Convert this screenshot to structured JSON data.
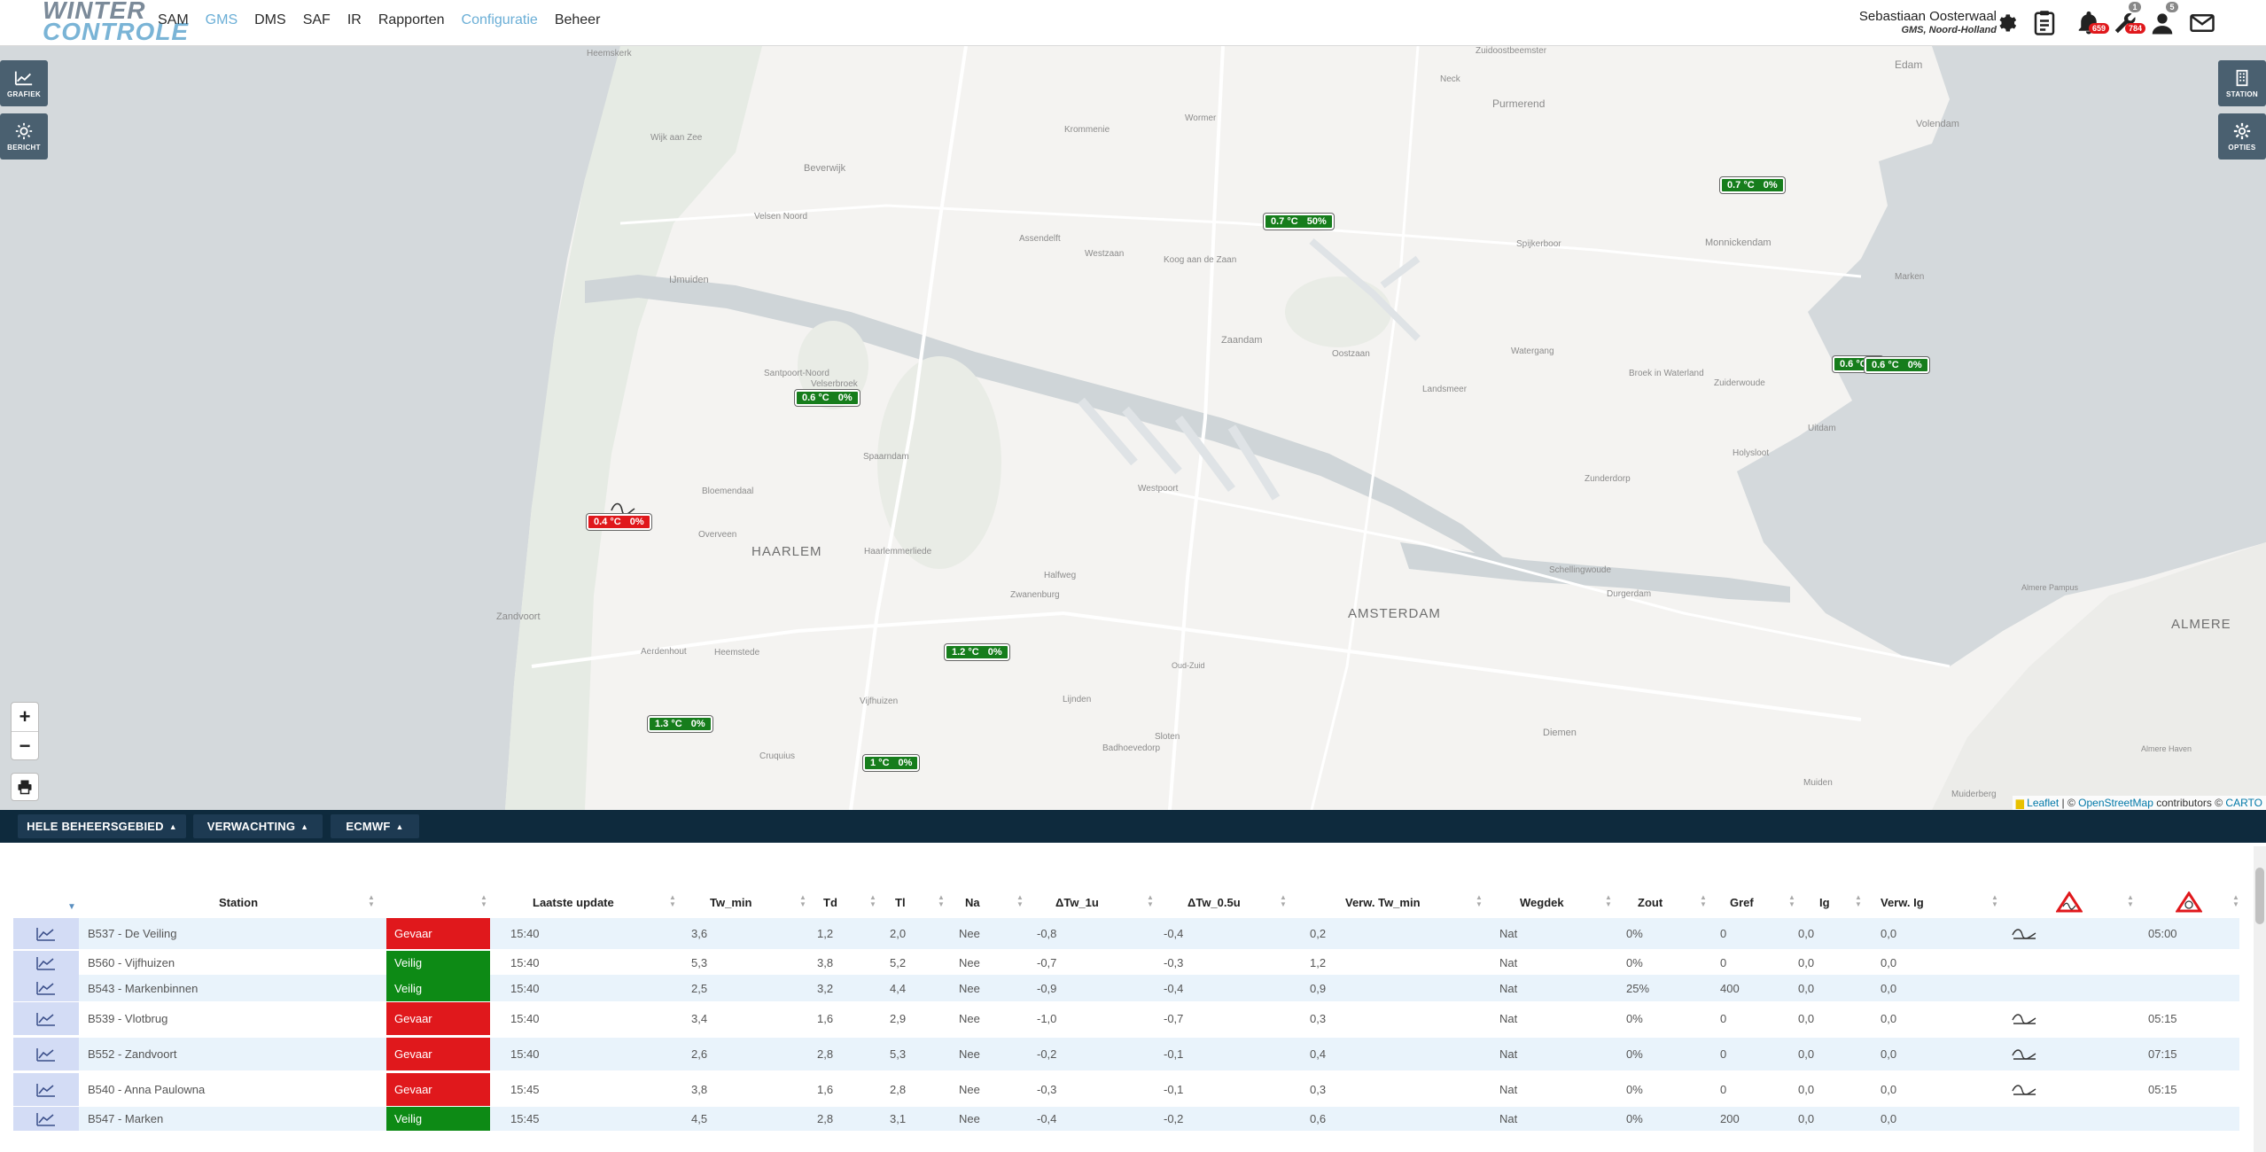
{
  "nav": {
    "logo_top": "WINTER",
    "logo_bottom": "CONTROLE",
    "items": [
      {
        "label": "SAM",
        "active": false
      },
      {
        "label": "GMS",
        "active": true
      },
      {
        "label": "DMS",
        "active": false
      },
      {
        "label": "SAF",
        "active": false
      },
      {
        "label": "IR",
        "active": false
      },
      {
        "label": "Rapporten",
        "active": false
      },
      {
        "label": "Configuratie",
        "active": true
      },
      {
        "label": "Beheer",
        "active": false
      }
    ],
    "user_name": "Sebastiaan Oosterwaal",
    "user_sub": "GMS, Noord-Holland",
    "alarm_badge": "659",
    "tool_badge_top": "1",
    "tool_badge": "784",
    "person_badge": "5"
  },
  "map_controls": {
    "left_buttons": [
      {
        "label": "GRAFIEK"
      },
      {
        "label": "BERICHT"
      }
    ],
    "right_buttons": [
      {
        "label": "STATION"
      },
      {
        "label": "OPTIES"
      }
    ],
    "zoom_in": "+",
    "zoom_out": "−",
    "attribution_leaflet": "Leaflet",
    "attribution_sep": " | © ",
    "attribution_osm": "OpenStreetMap",
    "attribution_rest": " contributors © ",
    "attribution_carto": "CARTO"
  },
  "places": [
    {
      "name": "Heemskerk"
    },
    {
      "name": "Zuidoostbeemster"
    },
    {
      "name": "Edam"
    },
    {
      "name": "Neck"
    },
    {
      "name": "Purmerend"
    },
    {
      "name": "Volendam"
    },
    {
      "name": "Wijk aan Zee"
    },
    {
      "name": "Krommenie"
    },
    {
      "name": "Wormer"
    },
    {
      "name": "Beverwijk"
    },
    {
      "name": "Velsen Noord"
    },
    {
      "name": "Assendelft"
    },
    {
      "name": "Westzaan"
    },
    {
      "name": "Koog aan de Zaan"
    },
    {
      "name": "IJmuiden"
    },
    {
      "name": "Spijkerboor"
    },
    {
      "name": "Oostzaan"
    },
    {
      "name": "Zaandam"
    },
    {
      "name": "Landsmeer"
    },
    {
      "name": "Watergang"
    },
    {
      "name": "Broek in Waterland"
    },
    {
      "name": "Monnickendam"
    },
    {
      "name": "Marken"
    },
    {
      "name": "Zuiderwoude"
    },
    {
      "name": "Uitdam"
    },
    {
      "name": "Holysloot"
    },
    {
      "name": "Santpoort-Noord"
    },
    {
      "name": "Velserbroek"
    },
    {
      "name": "Spaarndam"
    },
    {
      "name": "Westpoort"
    },
    {
      "name": "Bloemendaal"
    },
    {
      "name": "Overveen"
    },
    {
      "name": "HAARLEM"
    },
    {
      "name": "Haarlemmerliede"
    },
    {
      "name": "Halfweg"
    },
    {
      "name": "Zwanenburg"
    },
    {
      "name": "Zandvoort"
    },
    {
      "name": "AMSTERDAM"
    },
    {
      "name": "Schellingwoude"
    },
    {
      "name": "Durgerdam"
    },
    {
      "name": "Zunderdorp"
    },
    {
      "name": "Aerdenhout"
    },
    {
      "name": "Heemstede"
    },
    {
      "name": "Vijfhuizen"
    },
    {
      "name": "Lijnden"
    },
    {
      "name": "Diemen"
    },
    {
      "name": "Cruquius"
    },
    {
      "name": "Badhoevedorp"
    },
    {
      "name": "Sloten"
    },
    {
      "name": "Muiden"
    },
    {
      "name": "Muiderberg"
    },
    {
      "name": "ALMERE"
    },
    {
      "name": "Almere Pampus"
    },
    {
      "name": "Almere Haven"
    },
    {
      "name": "Oud-Zuid"
    }
  ],
  "markers": [
    {
      "temp": "0.7 °C",
      "pct": "50%",
      "color": "green"
    },
    {
      "temp": "0.7 °C",
      "pct": "0%",
      "color": "green"
    },
    {
      "temp": "0.6 °C",
      "pct": "",
      "color": "green"
    },
    {
      "temp": "0.6 °C",
      "pct": "0%",
      "color": "green"
    },
    {
      "temp": "0.6 °C",
      "pct": "0%",
      "color": "green"
    },
    {
      "temp": "0.4 °C",
      "pct": "0%",
      "color": "red"
    },
    {
      "temp": "1.2 °C",
      "pct": "0%",
      "color": "green"
    },
    {
      "temp": "1.3 °C",
      "pct": "0%",
      "color": "green"
    },
    {
      "temp": "1 °C",
      "pct": "0%",
      "color": "green"
    }
  ],
  "toolbar": {
    "area": "HELE BEHEERSGEBIED",
    "forecast": "VERWACHTING",
    "model": "ECMWF"
  },
  "table": {
    "headers": [
      "Station",
      "Laatste update",
      "Tw_min",
      "Td",
      "Tl",
      "Na",
      "ΔTw_1u",
      "ΔTw_0.5u",
      "Verw. Tw_min",
      "Wegdek",
      "Zout",
      "Gref",
      "Ig",
      "Verw. Ig"
    ],
    "rows": [
      {
        "station": "B537 - De Veiling",
        "status": "Gevaar",
        "status_color": "red",
        "update": "15:40",
        "tw_min": "3,6",
        "td": "1,2",
        "tl": "2,0",
        "na": "Nee",
        "dtw1": "-0,8",
        "dtw05": "-0,4",
        "verw_tw": "0,2",
        "wegdek": "Nat",
        "zout": "0%",
        "gref": "0",
        "ig": "0,0",
        "verw_ig": "0,0",
        "warn": true,
        "time": "05:00"
      },
      {
        "station": "B560 - Vijfhuizen",
        "status": "Veilig",
        "status_color": "green",
        "update": "15:40",
        "tw_min": "5,3",
        "td": "3,8",
        "tl": "5,2",
        "na": "Nee",
        "dtw1": "-0,7",
        "dtw05": "-0,3",
        "verw_tw": "1,2",
        "wegdek": "Nat",
        "zout": "0%",
        "gref": "0",
        "ig": "0,0",
        "verw_ig": "0,0",
        "warn": false,
        "time": ""
      },
      {
        "station": "B543 - Markenbinnen",
        "status": "Veilig",
        "status_color": "green",
        "update": "15:40",
        "tw_min": "2,5",
        "td": "3,2",
        "tl": "4,4",
        "na": "Nee",
        "dtw1": "-0,9",
        "dtw05": "-0,4",
        "verw_tw": "0,9",
        "wegdek": "Nat",
        "zout": "25%",
        "gref": "400",
        "ig": "0,0",
        "verw_ig": "0,0",
        "warn": false,
        "time": ""
      },
      {
        "station": "B539 - Vlotbrug",
        "status": "Gevaar",
        "status_color": "red",
        "update": "15:40",
        "tw_min": "3,4",
        "td": "1,6",
        "tl": "2,9",
        "na": "Nee",
        "dtw1": "-1,0",
        "dtw05": "-0,7",
        "verw_tw": "0,3",
        "wegdek": "Nat",
        "zout": "0%",
        "gref": "0",
        "ig": "0,0",
        "verw_ig": "0,0",
        "warn": true,
        "time": "05:15"
      },
      {
        "station": "B552 - Zandvoort",
        "status": "Gevaar",
        "status_color": "red",
        "update": "15:40",
        "tw_min": "2,6",
        "td": "2,8",
        "tl": "5,3",
        "na": "Nee",
        "dtw1": "-0,2",
        "dtw05": "-0,1",
        "verw_tw": "0,4",
        "wegdek": "Nat",
        "zout": "0%",
        "gref": "0",
        "ig": "0,0",
        "verw_ig": "0,0",
        "warn": true,
        "time": "07:15"
      },
      {
        "station": "B540 - Anna Paulowna",
        "status": "Gevaar",
        "status_color": "red",
        "update": "15:45",
        "tw_min": "3,8",
        "td": "1,6",
        "tl": "2,8",
        "na": "Nee",
        "dtw1": "-0,3",
        "dtw05": "-0,1",
        "verw_tw": "0,3",
        "wegdek": "Nat",
        "zout": "0%",
        "gref": "0",
        "ig": "0,0",
        "verw_ig": "0,0",
        "warn": true,
        "time": "05:15"
      },
      {
        "station": "B547 - Marken",
        "status": "Veilig",
        "status_color": "green",
        "update": "15:45",
        "tw_min": "4,5",
        "td": "2,8",
        "tl": "3,1",
        "na": "Nee",
        "dtw1": "-0,4",
        "dtw05": "-0,2",
        "verw_tw": "0,6",
        "wegdek": "Nat",
        "zout": "0%",
        "gref": "200",
        "ig": "0,0",
        "verw_ig": "0,0",
        "warn": false,
        "time": ""
      }
    ]
  },
  "colors": {
    "danger": "#e0181c",
    "safe": "#0d8a15",
    "marker_green": "#167d1c",
    "toolbar": "#0e2a3d",
    "nav_active": "#6aaed6",
    "row_alt": "#e9f3fb",
    "graph_cell": "#d3dcf5"
  }
}
